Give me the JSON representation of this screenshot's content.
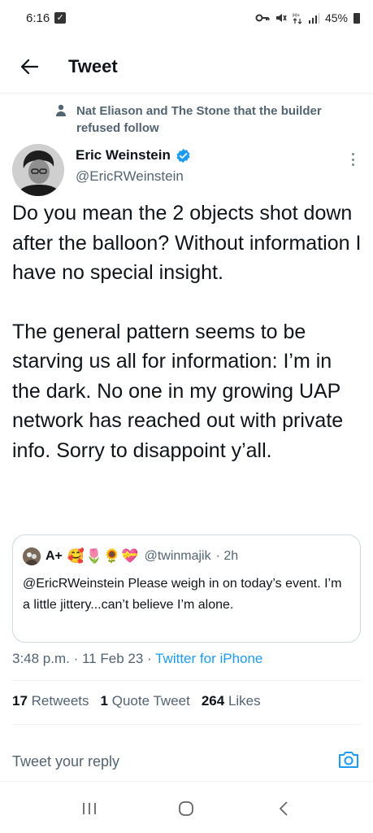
{
  "status_bar": {
    "time": "6:16",
    "battery": "45%"
  },
  "header": {
    "title": "Tweet"
  },
  "social_context": {
    "text": "Nat Eliason and The Stone that the builder refused follow"
  },
  "author": {
    "name": "Eric Weinstein",
    "handle": "@EricRWeinstein",
    "verified": true
  },
  "tweet": {
    "paragraph_1": "Do you mean the 2 objects shot down after the balloon? Without information I have no special insight.",
    "paragraph_2": "The general pattern seems to be starving us all for information: I’m in the dark. No one in my growing UAP network has reached out with private info. Sorry to disappoint y’all."
  },
  "quote": {
    "name": "A+",
    "emojis": "🥰🌷🌻💝",
    "handle": "@twinmajik",
    "time": "· 2h",
    "text": "@EricRWeinstein Please weigh in on today’s event. I’m a little jittery...can’t believe I’m alone."
  },
  "meta": {
    "time": "3:48 p.m.",
    "date": "· 11 Feb 23 ·",
    "source": "Twitter for iPhone"
  },
  "stats": {
    "retweets_count": "17",
    "retweets_label": "Retweets",
    "quotes_count": "1",
    "quotes_label": "Quote Tweet",
    "likes_count": "264",
    "likes_label": "Likes"
  },
  "reply": {
    "placeholder": "Tweet your reply"
  },
  "colors": {
    "accent": "#1d9bf0",
    "secondary_text": "#536471",
    "primary_text": "#0f1419"
  }
}
